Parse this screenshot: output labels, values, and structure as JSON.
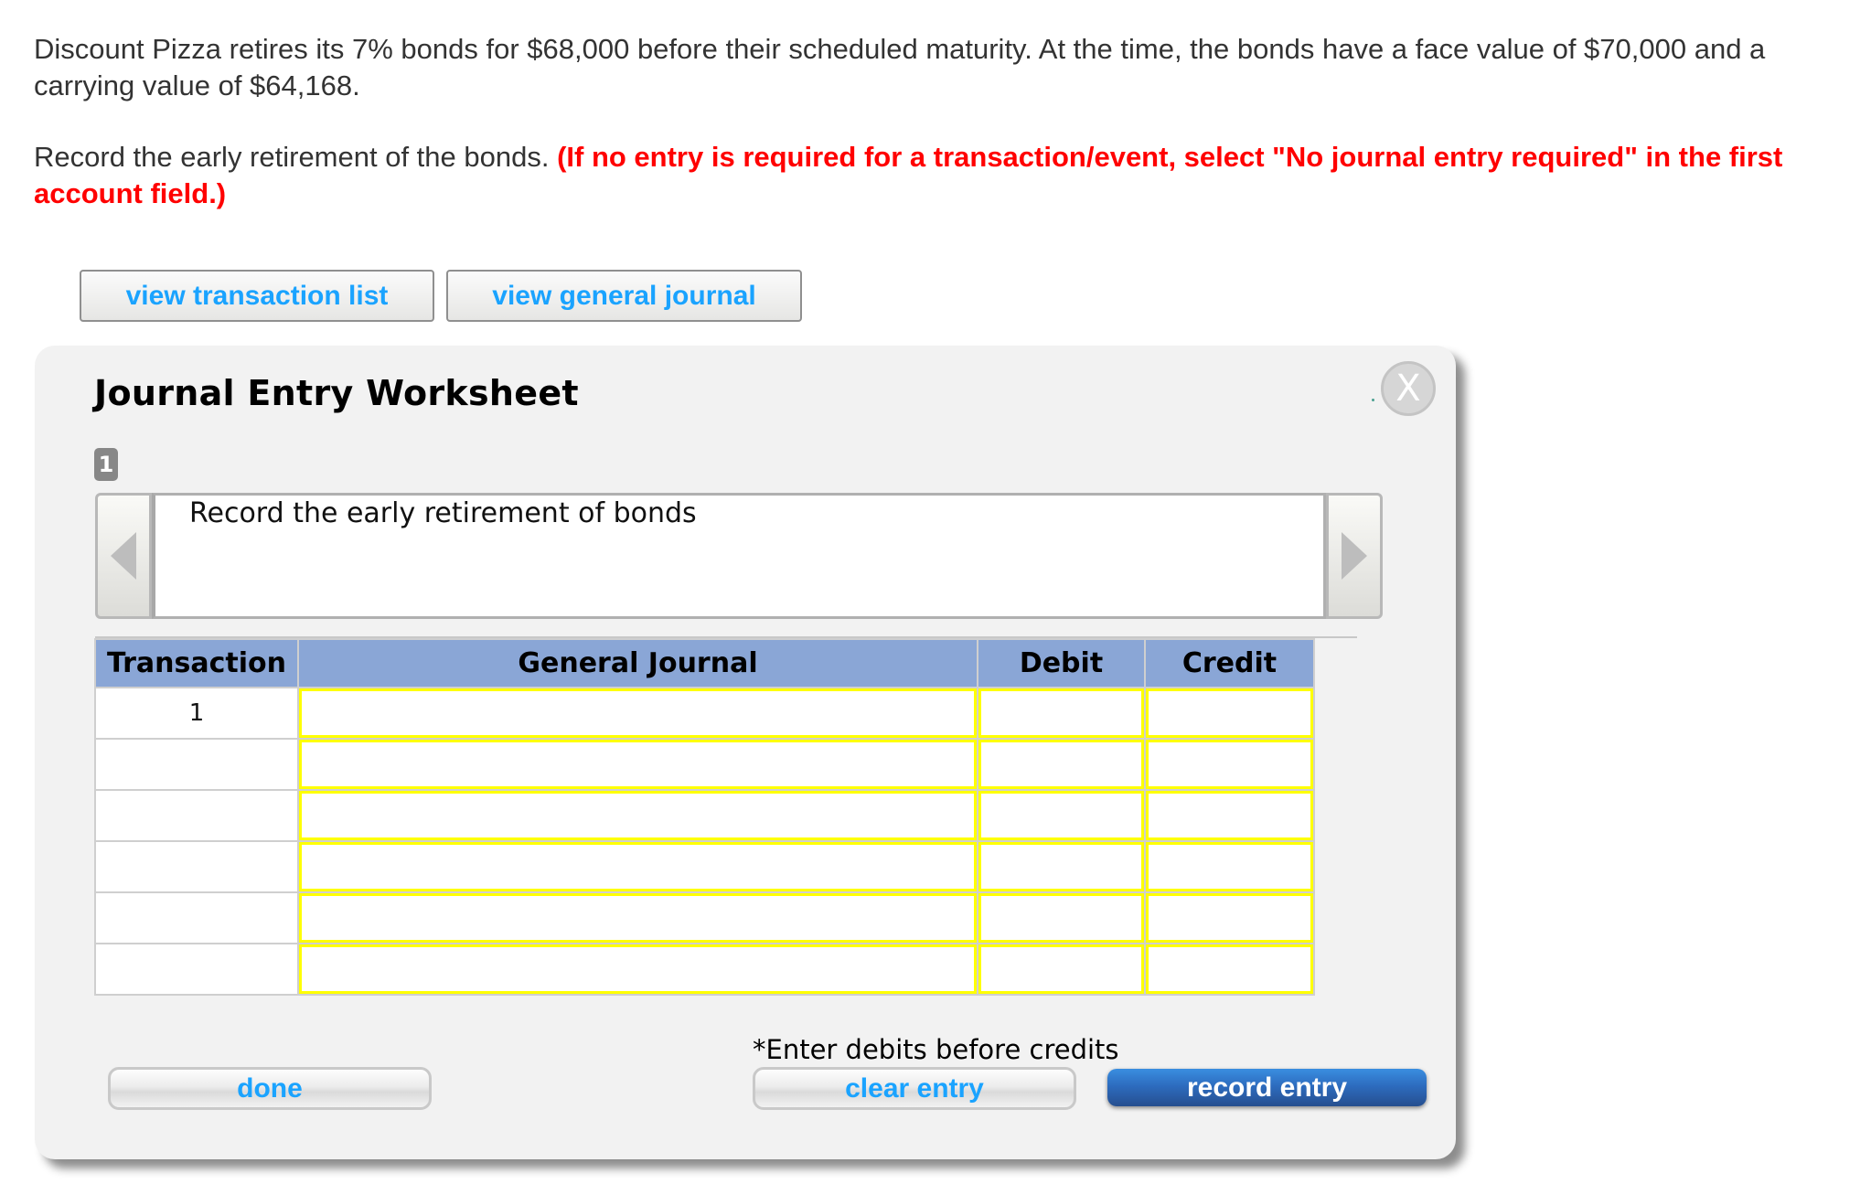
{
  "question": {
    "paragraph1": "Discount Pizza retires its 7% bonds for $68,000 before their scheduled maturity. At the time, the bonds have a face value of $70,000 and a carrying value of $64,168.",
    "paragraph2_text": "Record the early retirement of the bonds. ",
    "paragraph2_instruction": "(If no entry is required for a transaction/event, select \"No journal entry required\" in the first account field.)"
  },
  "top_buttons": {
    "view_transaction_list": "view transaction list",
    "view_general_journal": "view general journal"
  },
  "worksheet": {
    "title": "Journal Entry Worksheet",
    "close_label": "X",
    "badge": "1",
    "transaction_description": "Record the early retirement of bonds",
    "table": {
      "headers": [
        "Transaction",
        "General Journal",
        "Debit",
        "Credit"
      ],
      "rows": [
        {
          "transaction": "1",
          "account": "",
          "debit": "",
          "credit": ""
        },
        {
          "transaction": "",
          "account": "",
          "debit": "",
          "credit": ""
        },
        {
          "transaction": "",
          "account": "",
          "debit": "",
          "credit": ""
        },
        {
          "transaction": "",
          "account": "",
          "debit": "",
          "credit": ""
        },
        {
          "transaction": "",
          "account": "",
          "debit": "",
          "credit": ""
        },
        {
          "transaction": "",
          "account": "",
          "debit": "",
          "credit": ""
        }
      ]
    },
    "note": "*Enter debits before credits",
    "buttons": {
      "done": "done",
      "clear_entry": "clear entry",
      "record_entry": "record entry"
    }
  },
  "colors": {
    "instruction_red": "#ff0000",
    "link_blue": "#1aa3ff",
    "header_blue": "#8aa6d6",
    "input_border_yellow": "#ffff00",
    "record_button_blue": "#2d6cbf"
  }
}
